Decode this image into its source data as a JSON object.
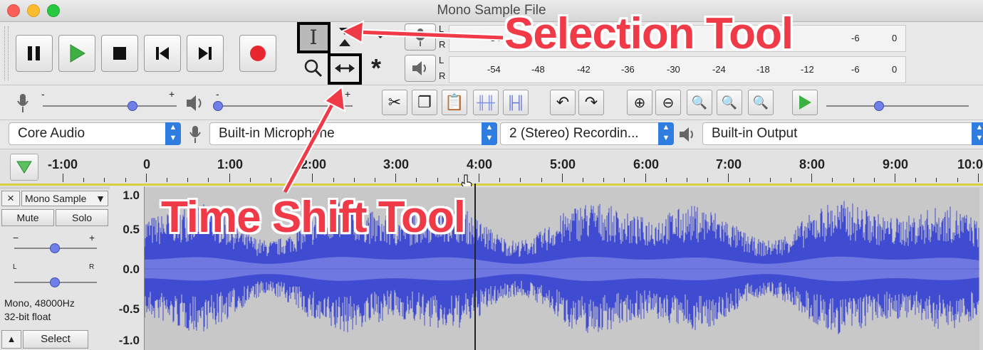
{
  "window": {
    "title": "Mono Sample File"
  },
  "colors": {
    "annotation": "#f03a48",
    "waveform": "#3f4bd0",
    "waveform_rms": "#6e78e0",
    "accent": "#2f7de0"
  },
  "transport": {
    "buttons": [
      "pause",
      "play",
      "stop",
      "skip-to-start",
      "skip-to-end",
      "record"
    ]
  },
  "meters": {
    "record_lr": [
      "L",
      "R"
    ],
    "playback_lr": [
      "L",
      "R"
    ],
    "record_scale_visible": [
      "-54",
      "-6",
      "0"
    ],
    "playback_scale": [
      "-54",
      "-48",
      "-42",
      "-36",
      "-30",
      "-24",
      "-18",
      "-12",
      "-6",
      "0"
    ]
  },
  "mixer": {
    "rec_min": "-",
    "rec_max": "+",
    "play_min": "-",
    "play_max": "+"
  },
  "devices": {
    "host": "Core Audio",
    "recording_device": "Built-in Microphone",
    "channels": "2 (Stereo) Recordin...",
    "playback_device": "Built-in Output"
  },
  "ruler": {
    "labels": [
      "-1:00",
      "0",
      "1:00",
      "2:00",
      "3:00",
      "4:00",
      "5:00",
      "6:00",
      "7:00",
      "8:00",
      "9:00",
      "10:0"
    ]
  },
  "track": {
    "name": "Mono Sample",
    "close": "×",
    "mute": "Mute",
    "solo": "Solo",
    "gain_min": "−",
    "gain_max": "+",
    "pan_left": "L",
    "pan_right": "R",
    "info_line1": "Mono, 48000Hz",
    "info_line2": "32-bit float",
    "select": "Select",
    "collapse": "▲"
  },
  "vertical_scale": [
    "1.0",
    "0.5",
    "0.0",
    "-0.5",
    "-1.0"
  ],
  "annotations": {
    "selection_tool": "Selection Tool",
    "time_shift_tool": "Time Shift Tool"
  }
}
